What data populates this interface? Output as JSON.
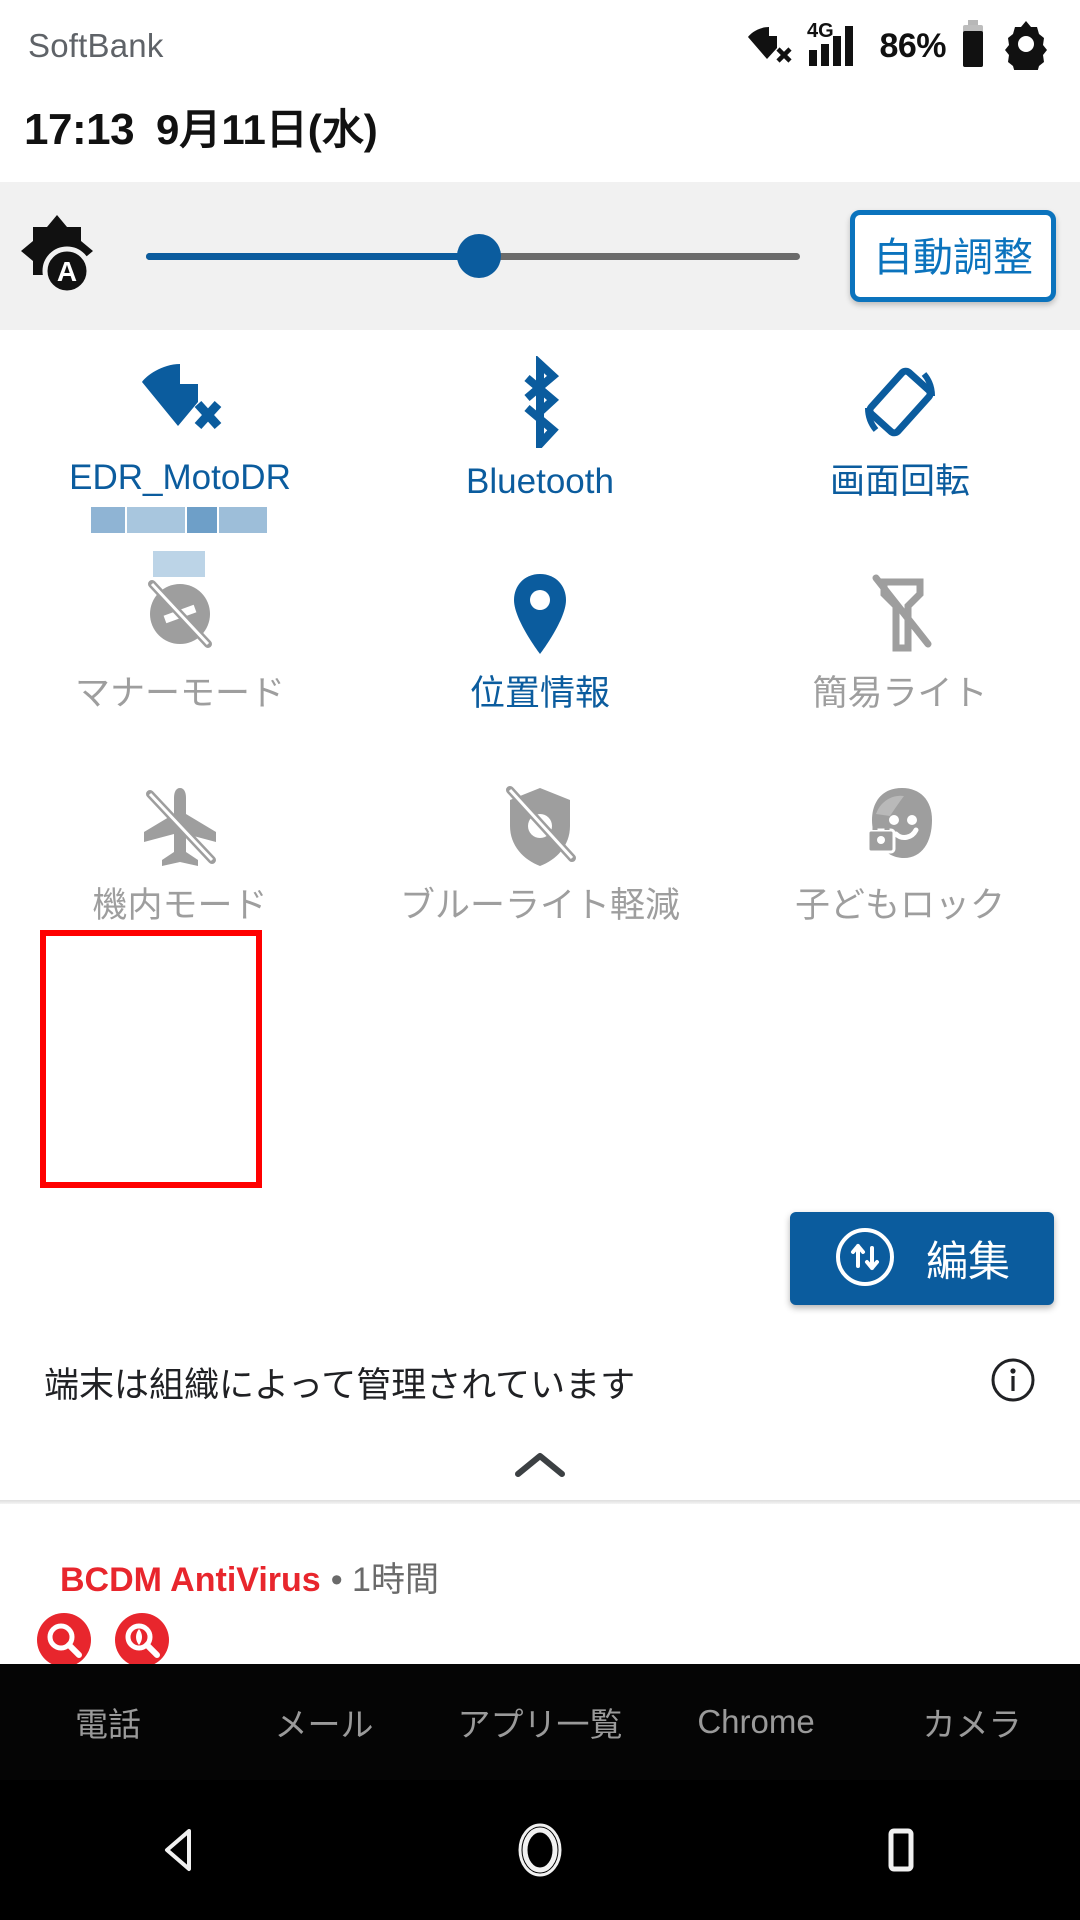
{
  "status_bar": {
    "carrier": "SoftBank",
    "battery_percent": "86%",
    "network_type": "4G",
    "icons": [
      "wifi-off-icon",
      "signal-4g-icon",
      "battery-icon",
      "gear-icon"
    ]
  },
  "clock": {
    "time": "17:13",
    "date": "9月11日(水)"
  },
  "brightness": {
    "icon": "auto-brightness-icon",
    "slider_value": 47,
    "auto_button_label": "自動調整"
  },
  "tiles": [
    [
      {
        "label": "EDR_MotoDR",
        "redacted": true,
        "state": "on",
        "icon": "wifi-off-icon"
      },
      {
        "label": "Bluetooth",
        "redacted": false,
        "state": "on",
        "icon": "bluetooth-icon"
      },
      {
        "label": "画面回転",
        "redacted": false,
        "state": "on",
        "icon": "screen-rotation-icon"
      }
    ],
    [
      {
        "label": "マナーモード",
        "redacted": false,
        "state": "off",
        "icon": "silent-mode-icon"
      },
      {
        "label": "位置情報",
        "redacted": false,
        "state": "on",
        "icon": "location-pin-icon"
      },
      {
        "label": "簡易ライト",
        "redacted": false,
        "state": "off",
        "icon": "flashlight-off-icon"
      }
    ],
    [
      {
        "label": "機内モード",
        "redacted": false,
        "state": "off",
        "icon": "airplane-mode-off-icon"
      },
      {
        "label": "ブルーライト軽減",
        "redacted": false,
        "state": "off",
        "icon": "blue-light-filter-off-icon"
      },
      {
        "label": "子どもロック",
        "redacted": false,
        "state": "off",
        "icon": "child-lock-icon"
      }
    ]
  ],
  "edit": {
    "label": "編集",
    "icon": "reorder-arrows-icon"
  },
  "managed_notice": {
    "text": "端末は組織によって管理されています",
    "info_icon": "info-icon"
  },
  "collapse": {
    "icon": "chevron-up-icon"
  },
  "notification": {
    "app": "BCDM AntiVirus",
    "meta": "• 1時間",
    "icons": [
      "scan-search-icon",
      "virus-scan-icon"
    ]
  },
  "dock": {
    "items": [
      {
        "label": "電話"
      },
      {
        "label": "メール"
      },
      {
        "label": "アプリ一覧"
      },
      {
        "label": "Chrome"
      },
      {
        "label": "カメラ"
      }
    ]
  },
  "nav_bar": {
    "back": "back-icon",
    "home": "home-icon",
    "recents": "recents-icon"
  },
  "colors": {
    "accent_blue": "#0b5c9e",
    "auto_button_blue": "#0b73bd",
    "off_grey": "#9e9e9e",
    "highlight_red": "#ff0000",
    "notification_red": "#e8262d",
    "panel_grey": "#f1f1f1"
  }
}
